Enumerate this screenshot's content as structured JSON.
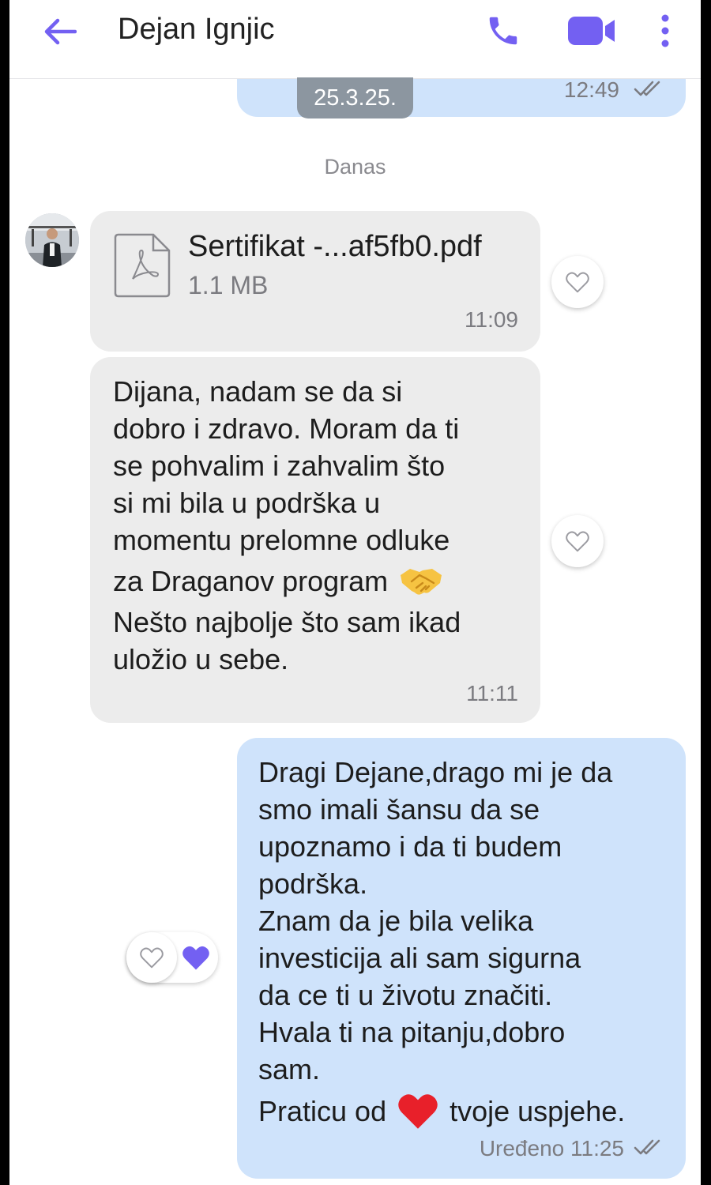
{
  "header": {
    "contact_name": "Dejan Ignjic"
  },
  "previous_message": {
    "time": "12:49",
    "date_pill": "25.3.25."
  },
  "day_separator": "Danas",
  "messages": [
    {
      "direction": "incoming",
      "type": "file",
      "file_name": "Sertifikat -...af5fb0.pdf",
      "file_size": "1.1 MB",
      "time": "11:09"
    },
    {
      "direction": "incoming",
      "type": "text",
      "lines": [
        "Dijana, nadam se da si",
        "dobro i zdravo. Moram da ti",
        "se pohvalim i zahvalim što",
        "si mi bila u podrška u",
        "momentu prelomne odluke",
        "za Draganov program",
        "Nešto najbolje što sam ikad",
        "uložio u sebe."
      ],
      "time": "11:11"
    },
    {
      "direction": "outgoing",
      "type": "text",
      "lines": [
        "Dragi Dejane,drago mi je da",
        "smo imali šansu da se",
        "upoznamo i da ti budem",
        "podrška.",
        "Znam da je bila velika",
        "investicija ali sam sigurna",
        "da ce ti u životu značiti.",
        "Hvala ti na pitanju,dobro",
        "sam.",
        "Praticu od",
        "tvoje uspjehe."
      ],
      "status": "Uređeno",
      "time": "11:25"
    }
  ],
  "colors": {
    "accent": "#7360f2",
    "outgoing_bubble": "#cfe3fb",
    "incoming_bubble": "#ececec",
    "date_pill": "#8c96a0"
  },
  "icons": {
    "back": "arrow-left-icon",
    "call": "phone-icon",
    "video": "video-camera-icon",
    "more": "more-vertical-icon",
    "like": "heart-outline-icon",
    "reaction": "heart-filled-icon",
    "read": "double-check-icon",
    "file": "pdf-file-icon"
  }
}
